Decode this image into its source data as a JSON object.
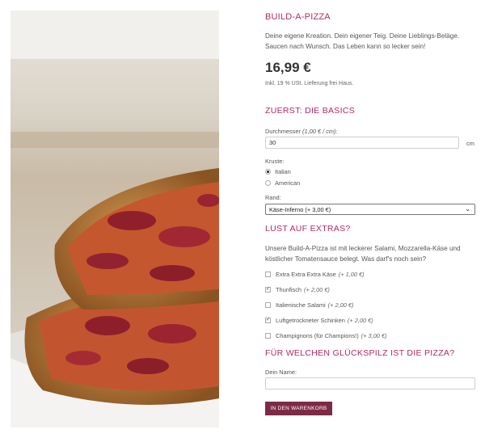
{
  "product": {
    "title": "BUILD-A-PIZZA",
    "description": "Deine eigene Kreation. Dein eigener Teig. Deine Lieblings-Beläge. Saucen nach Wunsch. Das Leben kann so lecker sein!",
    "price": "16,99 €",
    "tax_note": "Inkl. 19 % USt. Lieferung frei Haus."
  },
  "basics": {
    "heading": "ZUERST: DIE BASICS",
    "diameter_label": "Durchmesser",
    "diameter_hint": "(1,00 € / cm)",
    "diameter_colon": ":",
    "diameter_value": "30",
    "diameter_unit": "cm",
    "crust_label": "Kruste:",
    "crust_options": [
      {
        "label": "Italian",
        "checked": true
      },
      {
        "label": "American",
        "checked": false
      }
    ],
    "edge_label": "Rand:",
    "edge_selected": "Käse-Inferno (+ 3,00 €)"
  },
  "extras": {
    "heading": "LUST AUF EXTRAS?",
    "intro": "Unsere Build-A-Pizza ist mit leckerer Salami, Mozzarella-Käse und köstlicher Tomatensauce belegt. Was darf's noch sein?",
    "items": [
      {
        "label": "Extra Extra Extra Käse",
        "price": "(+ 1,00 €)",
        "checked": false
      },
      {
        "label": "Thunfisch",
        "price": "(+ 2,00 €)",
        "checked": true
      },
      {
        "label": "Italienische Salami",
        "price": "(+ 2,00 €)",
        "checked": false
      },
      {
        "label": "Luftgetrockneter Schinken",
        "price": "(+ 2,00 €)",
        "checked": true
      },
      {
        "label": "Champignons (für Champions!)",
        "price": "(+ 3,00 €)",
        "checked": false
      }
    ]
  },
  "recipient": {
    "heading": "FÜR WELCHEN GLÜCKSPILZ IST DIE PIZZA?",
    "name_label": "Dein Name:",
    "name_value": ""
  },
  "cart_button": "IN DEN WARENKORB",
  "colors": {
    "accent": "#b12a66",
    "button": "#7d2a47"
  }
}
